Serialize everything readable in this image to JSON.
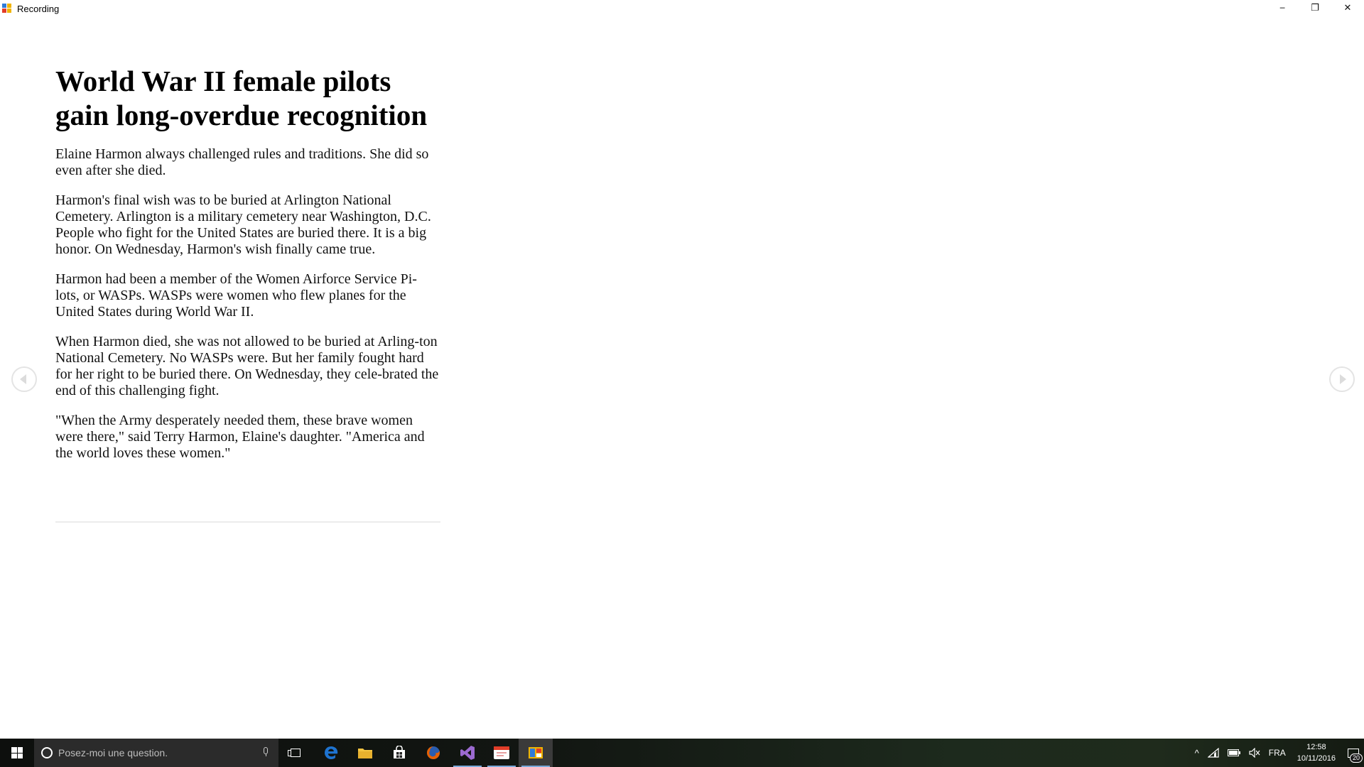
{
  "window": {
    "title": "Recording",
    "minimize_glyph": "─",
    "restore_glyph": "❐",
    "close_glyph": "✕"
  },
  "article": {
    "headline": "World War II female pilots gain long-overdue recognition",
    "paragraphs": [
      "Elaine Harmon always challenged rules and traditions. She did so even after she died.",
      "Harmon's final wish was to be buried at Arlington National Cemetery. Arlington is a military cemetery near Washington, D.C. People who fight for the United States are buried there. It is a big honor. On Wednesday, Harmon's wish finally came true.",
      "Harmon had been a member of the Women Airforce Service Pi-lots, or WASPs. WASPs were women who flew planes for the United States during World War II.",
      "When Harmon died, she was not allowed to be buried at Arling-ton National Cemetery. No WASPs were. But her family fought hard for her right to be buried there. On Wednesday, they cele-brated the end of this challenging fight.",
      "\"When the Army desperately needed them, these brave women were there,\" said Terry Harmon, Elaine's daughter. \"America and the world loves these women.\""
    ]
  },
  "taskbar": {
    "search_placeholder": "Posez-moi une question.",
    "pinned": [
      "task-view-icon",
      "edge-icon",
      "file-explorer-icon",
      "store-icon",
      "firefox-icon",
      "visual-studio-icon",
      "app-icon",
      "recording-app-icon"
    ],
    "tray": {
      "chevron": "^",
      "language": "FRA",
      "time": "12:58",
      "date": "10/11/2016",
      "notification_count": "20"
    }
  },
  "colors": {
    "taskbar_bg": "#121612",
    "search_bg": "#2b2b2b",
    "active_indicator": "#7aa9d9",
    "edge_blue": "#1e73d0",
    "vs_purple": "#68217a",
    "firefox_orange": "#e66000"
  }
}
